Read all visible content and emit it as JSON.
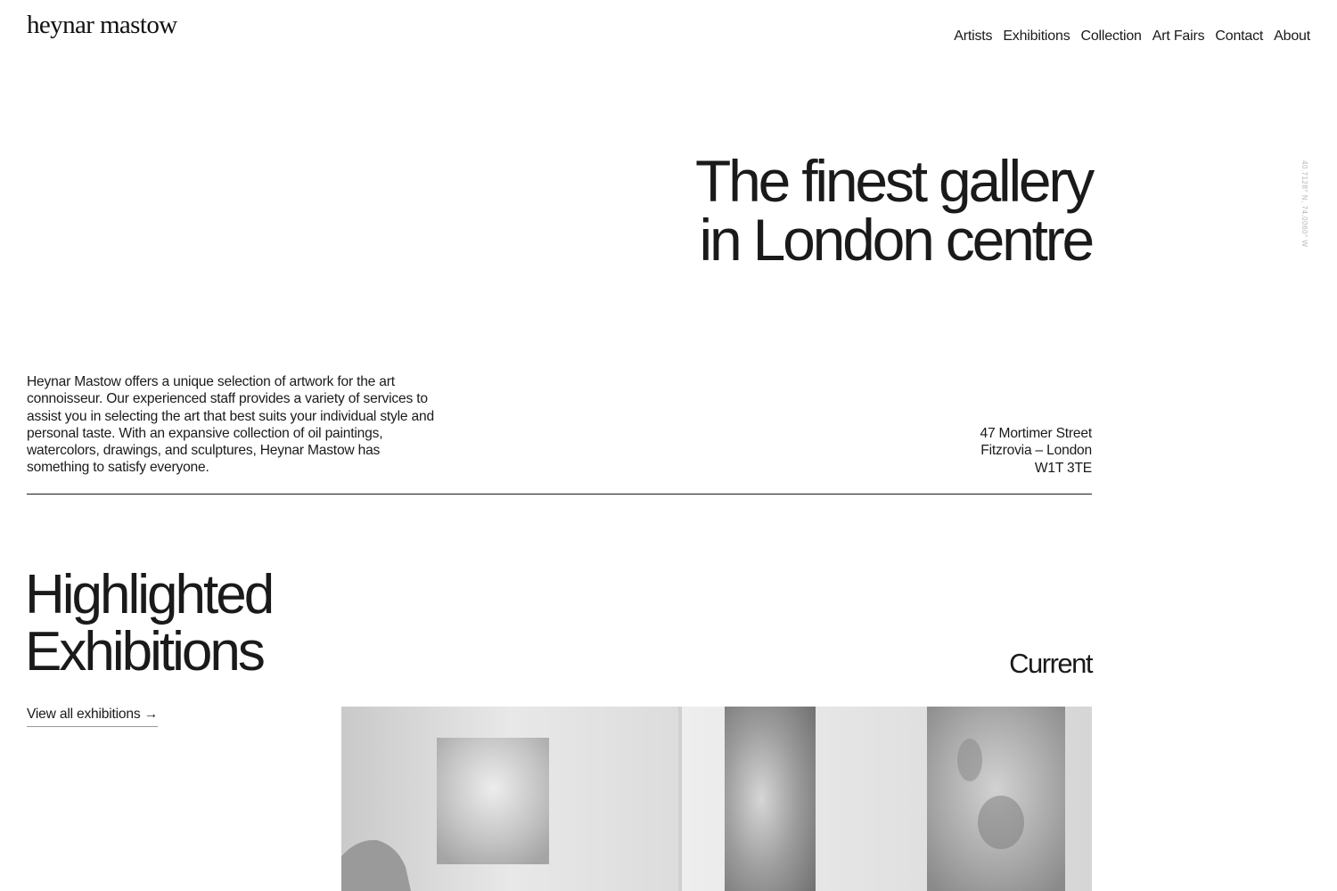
{
  "brand": {
    "logo_text": "heynar mastow"
  },
  "nav": {
    "items": [
      "Artists",
      "Exhibitions",
      "Collection",
      "Art Fairs",
      "Contact",
      "About"
    ]
  },
  "side_coordinates": "40.7128° N, 74.0060° W",
  "hero": {
    "title_line1": "The finest gallery",
    "title_line2": "in London centre"
  },
  "intro": {
    "text": "Heynar Mastow offers a unique selection of artwork for the art connoisseur. Our experienced staff provides a variety of services to assist you in selecting the art that best suits your individual style and personal taste. With an expansive collection of oil paintings, watercolors, drawings, and sculptures, Heynar Mastow has something to satisfy everyone."
  },
  "address": {
    "line1": "47 Mortimer Street",
    "line2": "Fitzrovia – London",
    "line3": "W1T 3TE"
  },
  "exhibitions": {
    "title_line1": "Highlighted",
    "title_line2": "Exhibitions",
    "view_all_label": "View all exhibitions →",
    "status_label": "Current"
  },
  "colors": {
    "text": "#1a1a1a",
    "background": "#ffffff",
    "muted": "#b5b5b5"
  }
}
